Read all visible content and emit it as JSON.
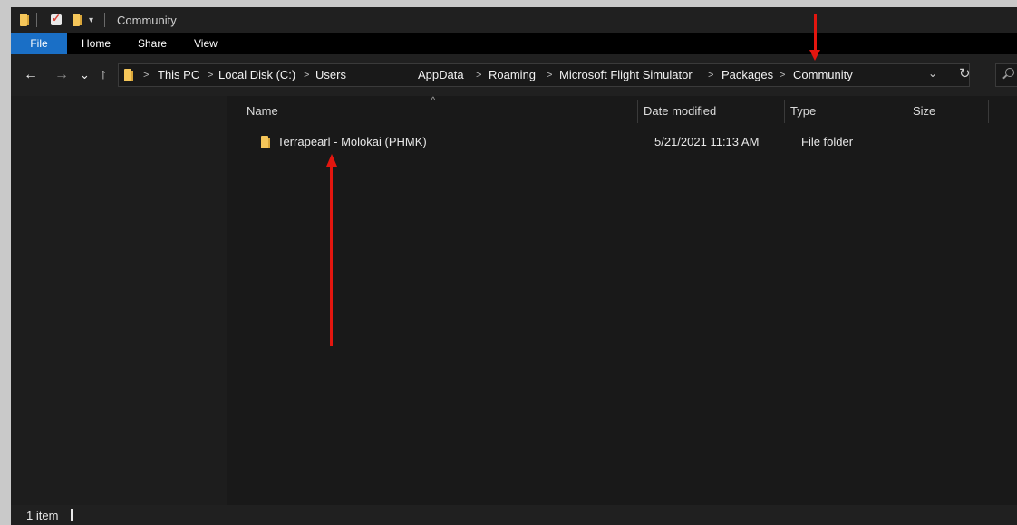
{
  "window": {
    "title": "Community",
    "quick_access_dropdown": "▾"
  },
  "ribbon": {
    "tabs": [
      {
        "label": "File"
      },
      {
        "label": "Home"
      },
      {
        "label": "Share"
      },
      {
        "label": "View"
      }
    ]
  },
  "nav": {
    "back": "←",
    "forward": "→",
    "recent": "⌄",
    "up": "↑",
    "refresh": "↻",
    "dropdown": "⌄"
  },
  "breadcrumbs": {
    "items": [
      "This PC",
      "Local Disk (C:)",
      "Users",
      "AppData",
      "Roaming",
      "Microsoft Flight Simulator",
      "Packages",
      "Community"
    ],
    "separator": ">"
  },
  "columns": {
    "name": "Name",
    "date_modified": "Date modified",
    "type": "Type",
    "size": "Size",
    "sort_indicator": "^"
  },
  "files": [
    {
      "name": "Terrapearl - Molokai (PHMK)",
      "date_modified": "5/21/2021 11:13 AM",
      "type": "File folder",
      "size": ""
    }
  ],
  "status": {
    "item_count": "1 item"
  },
  "colors": {
    "accent": "#1a6fc6",
    "annotation": "#e3160f",
    "folder": "#f5c65a",
    "background": "#191919"
  }
}
